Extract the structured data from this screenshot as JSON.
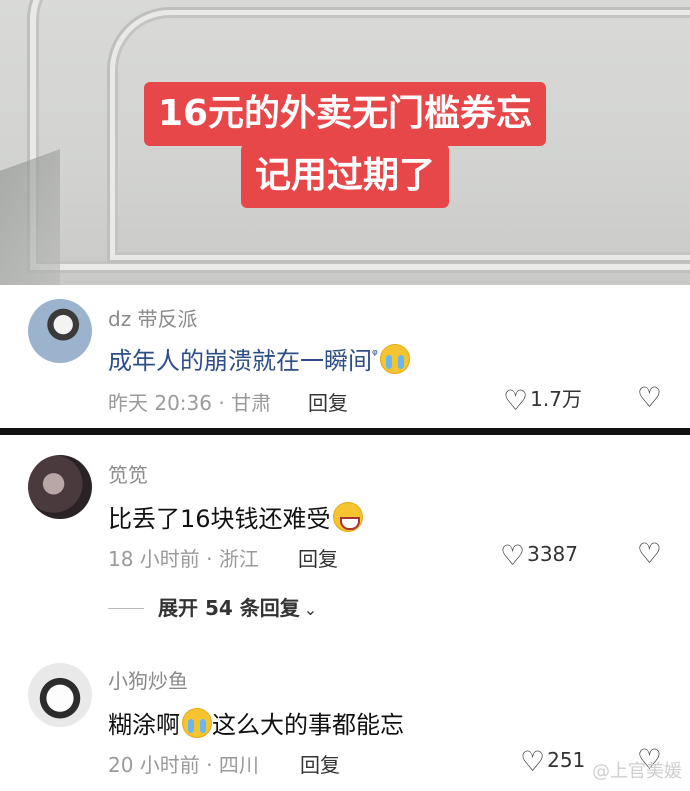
{
  "video": {
    "caption_line1": "16元的外卖无门槛券忘",
    "caption_line2": "记用过期了",
    "caption_color": "#e8474a"
  },
  "comments": [
    {
      "user": "dz 带反派",
      "text": "成年人的崩溃就在一瞬间",
      "emoji": "loudly-crying-face",
      "meta": "昨天 20:36 · 甘肃",
      "reply": "回复",
      "likes": "1.7万"
    },
    {
      "user": "笕笕",
      "text": "比丢了16块钱还难受",
      "emoji": "grinning-sweat-face",
      "meta": "18 小时前 · 浙江",
      "reply": "回复",
      "likes": "3387"
    },
    {
      "user": "小狗炒鱼",
      "text_before": "糊涂啊",
      "emoji": "loudly-crying-face",
      "text_after": "这么大的事都能忘",
      "meta": "20 小时前 · 四川",
      "reply": "回复",
      "likes": "251"
    }
  ],
  "expand_replies": "展开 54 条回复",
  "watermark": "@上官美媛"
}
